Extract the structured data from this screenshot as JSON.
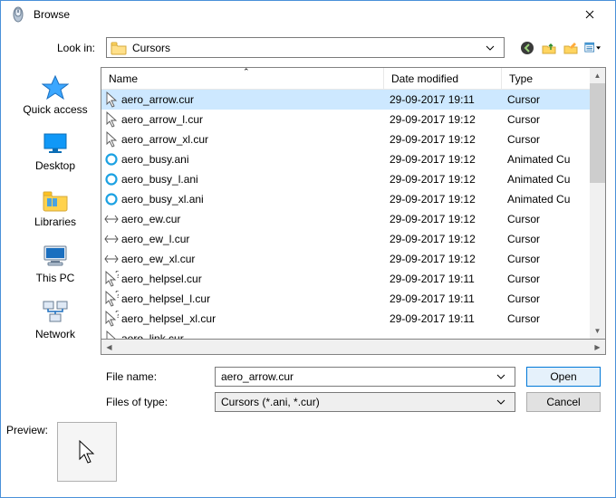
{
  "title": "Browse",
  "lookin": {
    "label": "Look in:",
    "value": "Cursors"
  },
  "places": [
    {
      "key": "quick-access",
      "label": "Quick access"
    },
    {
      "key": "desktop",
      "label": "Desktop"
    },
    {
      "key": "libraries",
      "label": "Libraries"
    },
    {
      "key": "this-pc",
      "label": "This PC"
    },
    {
      "key": "network",
      "label": "Network"
    }
  ],
  "columns": {
    "name": "Name",
    "date": "Date modified",
    "type": "Type"
  },
  "files": [
    {
      "icon": "arrow",
      "name": "aero_arrow.cur",
      "date": "29-09-2017 19:11",
      "type": "Cursor",
      "selected": true
    },
    {
      "icon": "arrow",
      "name": "aero_arrow_l.cur",
      "date": "29-09-2017 19:12",
      "type": "Cursor",
      "selected": false
    },
    {
      "icon": "arrow",
      "name": "aero_arrow_xl.cur",
      "date": "29-09-2017 19:12",
      "type": "Cursor",
      "selected": false
    },
    {
      "icon": "busy",
      "name": "aero_busy.ani",
      "date": "29-09-2017 19:12",
      "type": "Animated Cu",
      "selected": false
    },
    {
      "icon": "busy",
      "name": "aero_busy_l.ani",
      "date": "29-09-2017 19:12",
      "type": "Animated Cu",
      "selected": false
    },
    {
      "icon": "busy",
      "name": "aero_busy_xl.ani",
      "date": "29-09-2017 19:12",
      "type": "Animated Cu",
      "selected": false
    },
    {
      "icon": "ew",
      "name": "aero_ew.cur",
      "date": "29-09-2017 19:12",
      "type": "Cursor",
      "selected": false
    },
    {
      "icon": "ew",
      "name": "aero_ew_l.cur",
      "date": "29-09-2017 19:12",
      "type": "Cursor",
      "selected": false
    },
    {
      "icon": "ew",
      "name": "aero_ew_xl.cur",
      "date": "29-09-2017 19:12",
      "type": "Cursor",
      "selected": false
    },
    {
      "icon": "help",
      "name": "aero_helpsel.cur",
      "date": "29-09-2017 19:11",
      "type": "Cursor",
      "selected": false
    },
    {
      "icon": "help",
      "name": "aero_helpsel_l.cur",
      "date": "29-09-2017 19:11",
      "type": "Cursor",
      "selected": false
    },
    {
      "icon": "help",
      "name": "aero_helpsel_xl.cur",
      "date": "29-09-2017 19:11",
      "type": "Cursor",
      "selected": false
    },
    {
      "icon": "arrow",
      "name": "aero_link.cur",
      "date": "",
      "type": "",
      "selected": false
    }
  ],
  "filename": {
    "label": "File name:",
    "value": "aero_arrow.cur"
  },
  "filter": {
    "label": "Files of type:",
    "value": "Cursors (*.ani, *.cur)"
  },
  "buttons": {
    "open": "Open",
    "cancel": "Cancel"
  },
  "preview": {
    "label": "Preview:"
  }
}
